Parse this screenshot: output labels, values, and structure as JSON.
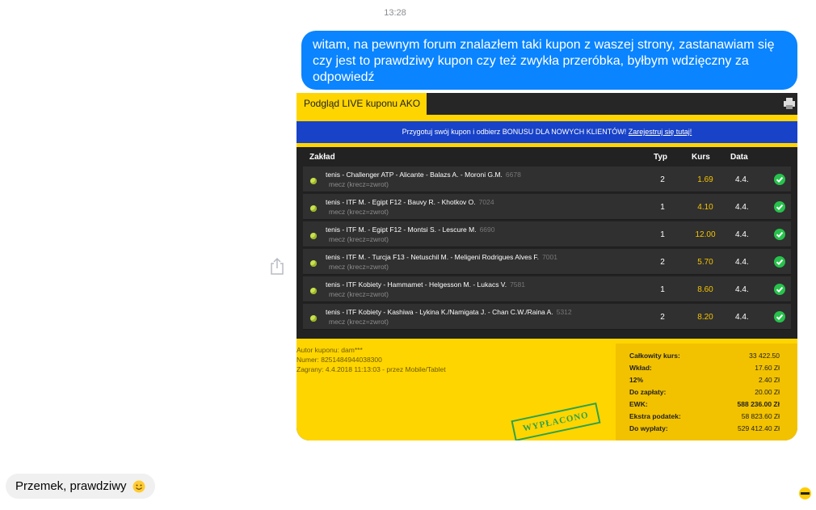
{
  "timestamp": "13:28",
  "messages": {
    "outgoing_text": "witam, na pewnym forum znalazłem taki kupon z waszej strony, zastanawiam się czy jest to prawdziwy kupon czy też zwykła przeróbka, byłbym wdzięczny za odpowiedź",
    "incoming_text": "Przemek, prawdziwy"
  },
  "coupon": {
    "tab_title": "Podgląd LIVE kuponu AKO",
    "banner_text": "Przygotuj swój kupon i odbierz BONUSU DLA NOWYCH KLIENTÓW!",
    "banner_link": "Zarejestruj się tutaj!",
    "headers": {
      "zaklad": "Zakład",
      "typ": "Typ",
      "kurs": "Kurs",
      "data": "Data"
    },
    "rows": [
      {
        "title": "tenis - Challenger ATP - Alicante - Balazs A. - Moroni G.M.",
        "num": "6678",
        "sub": "mecz (krecz=zwrot)",
        "typ": "2",
        "kurs": "1.69",
        "data": "4.4."
      },
      {
        "title": "tenis - ITF M. - Egipt F12 - Bauvy R. - Khotkov O.",
        "num": "7024",
        "sub": "mecz (krecz=zwrot)",
        "typ": "1",
        "kurs": "4.10",
        "data": "4.4."
      },
      {
        "title": "tenis - ITF M. - Egipt F12 - Montsi S. - Lescure M.",
        "num": "6690",
        "sub": "mecz (krecz=zwrot)",
        "typ": "1",
        "kurs": "12.00",
        "data": "4.4."
      },
      {
        "title": "tenis - ITF M. - Turcja F13 - Netuschil M. - Meligeni Rodrigues Alves F.",
        "num": "7001",
        "sub": "mecz (krecz=zwrot)",
        "typ": "2",
        "kurs": "5.70",
        "data": "4.4."
      },
      {
        "title": "tenis - ITF Kobiety - Hammamet - Helgesson M. - Lukacs V.",
        "num": "7581",
        "sub": "mecz (krecz=zwrot)",
        "typ": "1",
        "kurs": "8.60",
        "data": "4.4."
      },
      {
        "title": "tenis - ITF Kobiety - Kashiwa - Lykina K./Namigata J. - Chan C.W./Raina A.",
        "num": "5312",
        "sub": "mecz (krecz=zwrot)",
        "typ": "2",
        "kurs": "8.20",
        "data": "4.4."
      }
    ],
    "meta": {
      "author": "Autor kuponu: dam***",
      "number": "Numer: 8251484944038300",
      "played": "Zagrany: 4.4.2018 11:13:03 - przez Mobile/Tablet"
    },
    "stamp": "WYPŁACONO",
    "summary": [
      {
        "label": "Całkowity kurs:",
        "value": "33 422.50"
      },
      {
        "label": "Wkład:",
        "value": "17.60 Zł"
      },
      {
        "label": "12%",
        "value": "2.40 Zł"
      },
      {
        "label": "Do zapłaty:",
        "value": "20.00 Zł"
      },
      {
        "label": "EWK:",
        "value": "588 236.00 Zł"
      },
      {
        "label": "Ekstra podatek:",
        "value": "58 823.60 Zł"
      },
      {
        "label": "Do wypłaty:",
        "value": "529 412.40 Zł"
      }
    ]
  },
  "icons": [
    "share-icon",
    "printer-icon",
    "tennis-ball-icon",
    "check-icon",
    "smile-emoji-icon",
    "seen-avatar-icon"
  ],
  "colors": {
    "outgoing_bubble": "#0a84ff",
    "coupon_yellow": "#ffd500",
    "banner_blue": "#1842c8",
    "odds_yellow": "#f5c400",
    "check_green": "#27c24c"
  }
}
